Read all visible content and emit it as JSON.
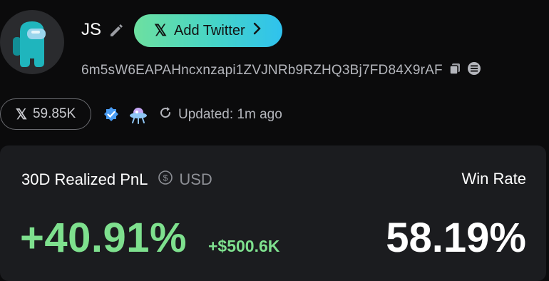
{
  "profile": {
    "name": "JS",
    "avatar_icon": "among-us-crewmate-icon",
    "address": "6m5sW6EAPAHncxnzapi1ZVJNRb9RZHQ3Bj7FD84X9rAF",
    "add_twitter_label": "Add Twitter",
    "twitter_followers": "59.85K",
    "updated_label": "Updated: 1m ago"
  },
  "stats": {
    "pnl_label": "30D Realized PnL",
    "currency": "USD",
    "pnl_percent": "+40.91%",
    "pnl_usd": "+$500.6K",
    "winrate_label": "Win Rate",
    "winrate": "58.19%"
  },
  "colors": {
    "accent_green": "#7ee08e",
    "button_gradient_start": "#6de0a0",
    "button_gradient_end": "#2fc2ee",
    "avatar_crewmate": "#1fb5bd"
  }
}
